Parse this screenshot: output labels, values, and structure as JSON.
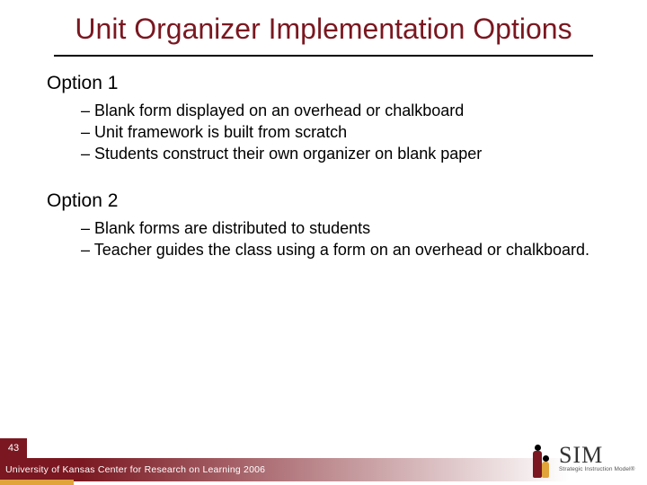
{
  "title": "Unit Organizer Implementation Options",
  "option1": {
    "heading": "Option 1",
    "bullets": [
      "Blank form displayed on an overhead or chalkboard",
      "Unit framework is built from scratch",
      "Students construct their own organizer on blank paper"
    ]
  },
  "option2": {
    "heading": "Option 2",
    "bullets": [
      "Blank forms are distributed to students",
      "Teacher guides the class using a form on an overhead or chalkboard."
    ]
  },
  "footer": {
    "page": "43",
    "credit": "University of Kansas Center for Research on Learning  2006",
    "logo_main": "SIM",
    "logo_sub": "Strategic Instruction Model®"
  }
}
